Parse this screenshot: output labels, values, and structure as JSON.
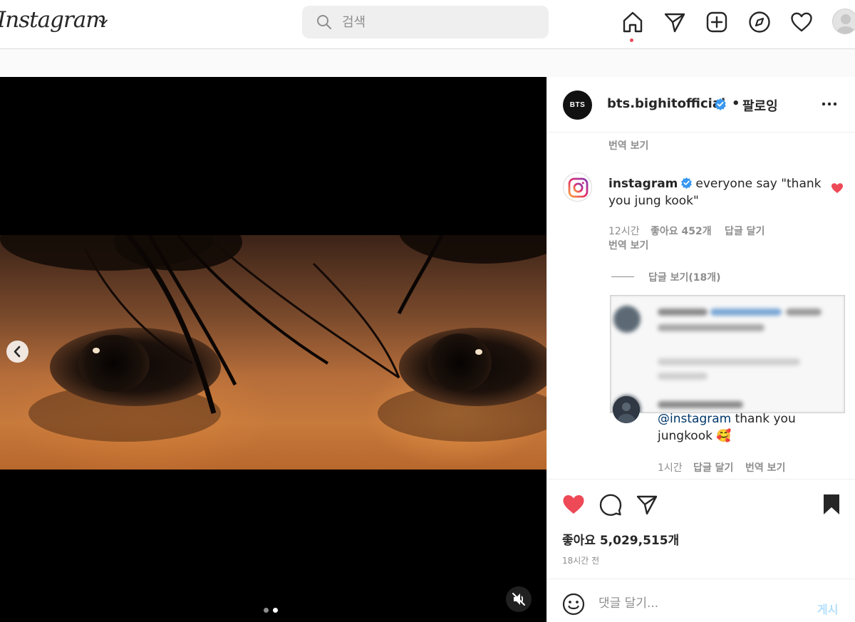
{
  "app": {
    "logo": "Instagram"
  },
  "search": {
    "placeholder": "검색"
  },
  "post": {
    "author": "bts.bighitofficial",
    "author_avatar_text": "BTS",
    "follow_label": "팔로잉",
    "separator": "•",
    "likes": "좋아요 5,029,515개",
    "time_ago": "18시간 전",
    "media_dots_count": 2,
    "media_active_dot": 1
  },
  "comments": {
    "cut_translate": "번역 보기",
    "main": {
      "user": "instagram",
      "text": "everyone say \"thank you jung kook\"",
      "time": "12시간",
      "likes": "좋아요 452개",
      "reply": "답글 달기",
      "translate": "번역 보기",
      "liked": true
    },
    "view_replies": "답글 보기(18개)",
    "reply": {
      "mention": "@instagram",
      "text": " thank you jungkook 🥰",
      "time": "1시간",
      "reply": "답글 달기",
      "translate": "번역 보기"
    }
  },
  "composer": {
    "placeholder": "댓글 달기...",
    "post_label": "게시"
  },
  "colors": {
    "like_red": "#ed4956",
    "verified_blue": "#3897f0",
    "post_disabled": "#b2dffc"
  },
  "icons": [
    "chevron-down-icon",
    "search-icon",
    "home-icon",
    "direct-icon",
    "new-post-icon",
    "explore-icon",
    "activity-heart-icon",
    "more-icon",
    "heart-filled-icon",
    "comment-icon",
    "share-icon",
    "bookmark-filled-icon",
    "emoji-icon",
    "mute-icon",
    "chevron-left-icon",
    "verified-badge-icon"
  ]
}
